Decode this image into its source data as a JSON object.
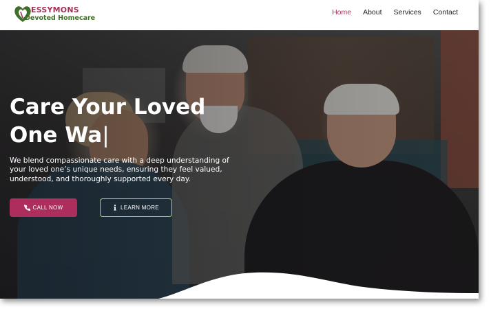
{
  "brand": {
    "name_line1": "ESSYMONS",
    "name_line2": "Devoted Homecare",
    "logo_icon": "heart-leaf-icon",
    "colors": {
      "primary": "#a3335c",
      "secondary": "#3f6f2a",
      "accent_border": "#b7d35a"
    }
  },
  "nav": {
    "items": [
      {
        "label": "Home",
        "active": true
      },
      {
        "label": "About",
        "active": false
      },
      {
        "label": "Services",
        "active": false
      },
      {
        "label": "Contact",
        "active": false
      }
    ]
  },
  "hero": {
    "headline_line1": "Care Your Loved",
    "headline_line2": "One Wa",
    "cursor": "|",
    "description": "We blend compassionate care with a deep understanding of your loved one’s unique needs, ensuring they feel valued, understood, and thoroughly supported every day.",
    "call_button": {
      "label": "CALL NOW",
      "icon": "phone-icon"
    },
    "learn_button": {
      "label": "LEARN MORE",
      "icon": "info-icon"
    }
  }
}
